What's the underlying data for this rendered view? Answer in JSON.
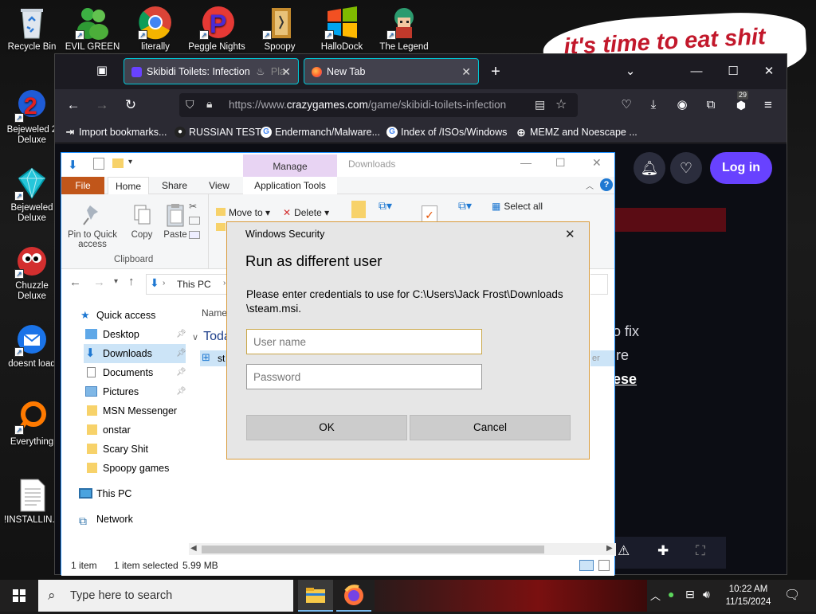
{
  "desktop": {
    "banner_text": "it's time to eat shit",
    "icons": [
      {
        "label": "Recycle Bin",
        "icon": "recycle-bin-icon"
      },
      {
        "label": "EVIL GREEN",
        "icon": "msn-messenger-icon"
      },
      {
        "label": "literally",
        "icon": "chrome-icon"
      },
      {
        "label": "Peggle Nights",
        "icon": "peggle-icon"
      },
      {
        "label": "Spoopy",
        "icon": "spoopy-icon"
      },
      {
        "label": "HalloDock",
        "icon": "windows-logo-icon"
      },
      {
        "label": "The Legend",
        "icon": "legend-game-icon"
      },
      {
        "label": "Bejeweled 2 Deluxe",
        "icon": "bejeweled-2-icon"
      },
      {
        "label": "Bejeweled Deluxe",
        "icon": "bejeweled-icon"
      },
      {
        "label": "Chuzzle Deluxe",
        "icon": "chuzzle-icon"
      },
      {
        "label": "doesnt load",
        "icon": "thunderbird-icon"
      },
      {
        "label": "Everything",
        "icon": "everything-search-icon"
      },
      {
        "label": "!INSTALLIN...",
        "icon": "document-icon"
      }
    ]
  },
  "browser": {
    "tabs": [
      {
        "label": "Skibidi Toilets: Infection",
        "extra": "Pla",
        "active": true
      },
      {
        "label": "New Tab",
        "active": false
      }
    ],
    "new_tab": "+",
    "url_prefix": "https://www.",
    "url_main": "crazygames.com",
    "url_suffix": "/game/skibidi-toilets-infection",
    "extension_badge": "29",
    "bookmarks": [
      {
        "label": "Import bookmarks...",
        "icon": "import-icon"
      },
      {
        "label": "RUSSIAN TEST",
        "icon": "bomb-icon"
      },
      {
        "label": "Endermanch/Malware...",
        "icon": "google-icon"
      },
      {
        "label": "Index of /ISOs/Windows",
        "icon": "google-icon"
      },
      {
        "label": "MEMZ and Noescape ...",
        "icon": "globe-icon"
      }
    ],
    "page": {
      "login_label": "Log in",
      "partial_text_1": "o fix",
      "partial_text_2": "re",
      "partial_text_3": "ese"
    }
  },
  "explorer": {
    "context_tab": "Manage",
    "title": "Downloads",
    "ribbon_tabs": [
      "File",
      "Home",
      "Share",
      "View",
      "Application Tools"
    ],
    "ribbon": {
      "pin_label": "Pin to Quick access",
      "copy_label": "Copy",
      "paste_label": "Paste",
      "clipboard_group": "Clipboard",
      "move_to": "Move to",
      "delete": "Delete",
      "select_all": "Select all"
    },
    "address": {
      "this_pc": "This PC"
    },
    "column_name": "Name",
    "group_today": "Toda",
    "file_partial": "st",
    "file_type_partial": "er",
    "nav": [
      {
        "label": "Quick access",
        "icon": "star-icon",
        "pinned": false
      },
      {
        "label": "Desktop",
        "icon": "desktop-folder-icon",
        "pinned": true
      },
      {
        "label": "Downloads",
        "icon": "downloads-folder-icon",
        "pinned": true
      },
      {
        "label": "Documents",
        "icon": "documents-folder-icon",
        "pinned": true
      },
      {
        "label": "Pictures",
        "icon": "pictures-folder-icon",
        "pinned": true
      },
      {
        "label": "MSN Messenger",
        "icon": "folder-icon",
        "pinned": false
      },
      {
        "label": "onstar",
        "icon": "folder-icon",
        "pinned": false
      },
      {
        "label": "Scary Shit",
        "icon": "folder-icon",
        "pinned": false
      },
      {
        "label": "Spoopy games",
        "icon": "folder-icon",
        "pinned": false
      },
      {
        "label": "This PC",
        "icon": "this-pc-icon",
        "pinned": false
      },
      {
        "label": "Network",
        "icon": "network-icon",
        "pinned": false
      }
    ],
    "status": {
      "items": "1 item",
      "selected": "1 item selected",
      "size": "5.99 MB"
    }
  },
  "dialog": {
    "window_title": "Windows Security",
    "heading": "Run as different user",
    "message_line1": "Please enter credentials to use for C:\\Users\\Jack Frost\\Downloads",
    "message_line2": "\\steam.msi.",
    "username_placeholder": "User name",
    "password_placeholder": "Password",
    "ok_label": "OK",
    "cancel_label": "Cancel"
  },
  "taskbar": {
    "search_placeholder": "Type here to search",
    "time": "10:22 AM",
    "date": "11/15/2024"
  },
  "colors": {
    "firefox_accent": "#00c8d7",
    "login_purple": "#6842ff",
    "dialog_border": "#d89a3a",
    "explorer_file_tab": "#c1561a",
    "manage_tab": "#e8d4f3"
  }
}
